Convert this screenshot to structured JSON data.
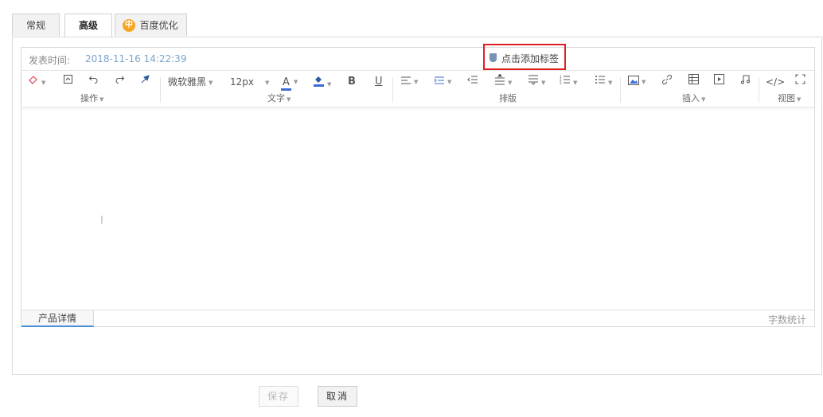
{
  "tabs": [
    {
      "label": "常规"
    },
    {
      "label": "高级"
    },
    {
      "label": "百度优化",
      "badge": "中"
    }
  ],
  "meta": {
    "label": "发表时间:",
    "time": "2018-11-16 14:22:39",
    "tag_link": "点击添加标签"
  },
  "toolbar": {
    "font_family": "微软雅黑",
    "font_size": "12px",
    "font_color_glyph": "A",
    "bold_glyph": "B",
    "underline_glyph": "U",
    "groups": {
      "operation": "操作",
      "text": "文字",
      "layout": "排版",
      "insert": "插入",
      "view": "视图"
    }
  },
  "editor": {
    "footer_tab": "产品详情",
    "wordcount": "字数统计"
  },
  "actions": {
    "save": "保存",
    "cancel": "取消"
  },
  "colors": {
    "accent": "#4a90d9",
    "highlight_border": "#e02020",
    "badge": "#f5a623"
  }
}
